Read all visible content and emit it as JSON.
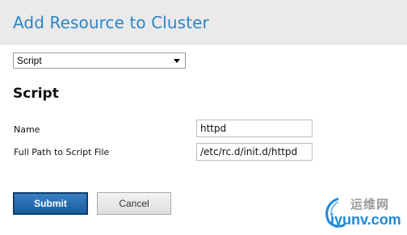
{
  "dialog": {
    "title": "Add Resource to Cluster"
  },
  "resource_type": {
    "selected": "Script"
  },
  "section": {
    "title": "Script"
  },
  "fields": [
    {
      "label": "Name",
      "value": "httpd"
    },
    {
      "label": "Full Path to Script File",
      "value": "/etc/rc.d/init.d/httpd"
    }
  ],
  "buttons": {
    "submit": "Submit",
    "cancel": "Cancel"
  },
  "watermark": {
    "top": "运维网",
    "bottom": "iyunv.com"
  },
  "colors": {
    "title": "#2b85c4",
    "submit_bg": "#1f5f9f",
    "watermark_blue": "#1f88d6"
  }
}
